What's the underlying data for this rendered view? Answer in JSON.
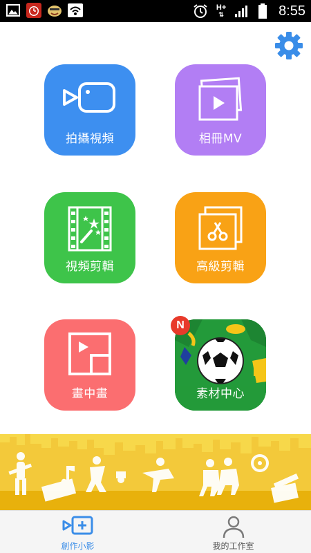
{
  "status_bar": {
    "time": "8:55",
    "network": "H+",
    "left_icons": [
      "gallery-icon",
      "alarm-app-icon",
      "emoji-app-icon",
      "wifi-icon"
    ],
    "right_icons": [
      "alarm-clock-icon",
      "vibrate-icon",
      "signal-icon",
      "battery-icon"
    ]
  },
  "settings": {
    "icon": "gear-icon",
    "color": "#3a8de8"
  },
  "tiles": [
    {
      "label": "拍攝視頻",
      "icon": "camera-icon",
      "color": "#3d8ff0"
    },
    {
      "label": "相冊MV",
      "icon": "photo-album-icon",
      "color": "#b27ef4"
    },
    {
      "label": "視頻剪輯",
      "icon": "film-magic-icon",
      "color": "#3ec44a"
    },
    {
      "label": "高級剪輯",
      "icon": "scissors-photo-icon",
      "color": "#f9a215"
    },
    {
      "label": "畫中畫",
      "icon": "picture-in-picture-icon",
      "color": "#fb6e70"
    },
    {
      "label": "素材中心",
      "icon": "soccer-ball-icon",
      "color": "#239a3a",
      "badge": "N"
    }
  ],
  "bottom_nav": {
    "items": [
      {
        "label": "創作小影",
        "icon": "video-add-icon",
        "active": true
      },
      {
        "label": "我的工作室",
        "icon": "user-icon",
        "active": false
      }
    ],
    "active_color": "#3a8de8"
  },
  "banner": {
    "color": "#f5c518"
  }
}
